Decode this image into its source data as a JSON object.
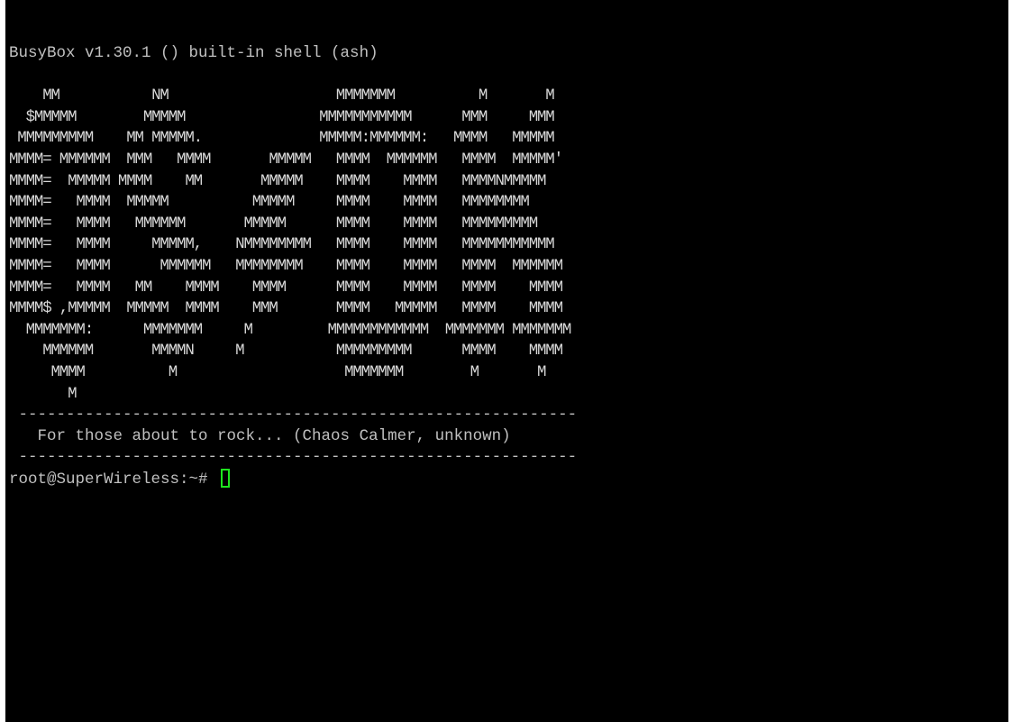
{
  "terminal": {
    "banner": "BusyBox v1.30.1 () built-in shell (ash)",
    "logo_lines": [
      "",
      "    MM           NM                    MMMMMMM          M       M",
      "  $MMMMM        MMMMM                MMMMMMMMMMM      MMM     MMM",
      " MMMMMMMMM    MM MMMMM.              MMMMM:MMMMMM:   MMMM   MMMMM",
      "MMMM= MMMMMM  MMM   MMMM       MMMMM   MMMM  MMMMMM   MMMM  MMMMM'",
      "MMMM=  MMMMM MMMM    MM       MMMMM    MMMM    MMMM   MMMMNMMMMM",
      "MMMM=   MMMM  MMMMM          MMMMM     MMMM    MMMM   MMMMMMMM",
      "MMMM=   MMMM   MMMMMM       MMMMM      MMMM    MMMM   MMMMMMMMM",
      "MMMM=   MMMM     MMMMM,    NMMMMMMMM   MMMM    MMMM   MMMMMMMMMMM",
      "MMMM=   MMMM      MMMMMM   MMMMMMMM    MMMM    MMMM   MMMM  MMMMMM",
      "MMMM=   MMMM   MM    MMMM    MMMM      MMMM    MMMM   MMMM    MMMM",
      "MMMM$ ,MMMMM  MMMMM  MMMM    MMM       MMMM   MMMMM   MMMM    MMMM",
      "  MMMMMMM:      MMMMMMM     M         MMMMMMMMMMMM  MMMMMMM MMMMMMM",
      "    MMMMMM       MMMMN     M           MMMMMMMMM      MMMM    MMMM",
      "     MMMM          M                    MMMMMMM        M       M",
      "       M"
    ],
    "divider_top": " -----------------------------------------------------------",
    "tagline": "   For those about to rock... (Chaos Calmer, unknown)",
    "divider_bottom": " -----------------------------------------------------------",
    "prompt": "root@SuperWireless:~# ",
    "cursor_color": "#1ee61e",
    "background_color": "#000000",
    "text_color": "#c0c0c0"
  }
}
